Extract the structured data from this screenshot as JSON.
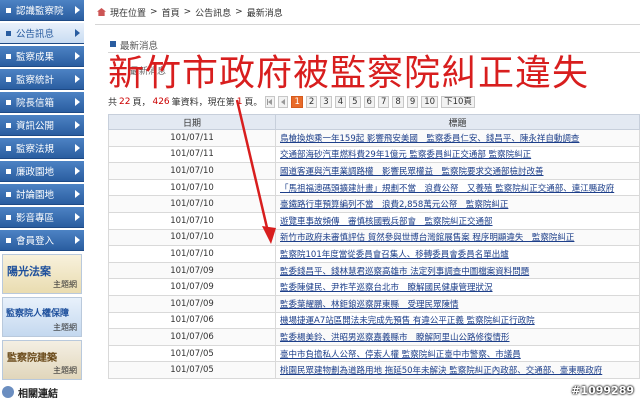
{
  "sidebar": {
    "items": [
      {
        "label": "認識監察院",
        "active": false
      },
      {
        "label": "公告訊息",
        "active": true
      },
      {
        "label": "監察成果",
        "active": false
      },
      {
        "label": "監察統計",
        "active": false
      },
      {
        "label": "院長信箱",
        "active": false
      },
      {
        "label": "資訊公開",
        "active": false
      },
      {
        "label": "監察法規",
        "active": false
      },
      {
        "label": "廉政園地",
        "active": false
      },
      {
        "label": "討論園地",
        "active": false
      },
      {
        "label": "影音專區",
        "active": false
      },
      {
        "label": "會員登入",
        "active": false
      }
    ],
    "banners": [
      {
        "title": "陽光法案",
        "subtitle": "主題網"
      },
      {
        "title": "監察院人權保障",
        "subtitle": "主題網"
      },
      {
        "title": "監察院建築",
        "subtitle": "主題網"
      }
    ],
    "related_label": "相關連結"
  },
  "breadcrumb": {
    "location": "現在位置",
    "items": [
      "首頁",
      "公告訊息",
      "最新消息"
    ],
    "sep": ">"
  },
  "section_title": "最新消息",
  "list_label": "最新消息",
  "overlay_caption": "新竹市政府被監察院糾正違失",
  "paging": {
    "prefix": "共",
    "total_items": "22",
    "mid": "頁，",
    "total_records": "426",
    "mid2": "筆資料，現在第",
    "current": "1",
    "suffix": "頁。",
    "pages": [
      "1",
      "2",
      "3",
      "4",
      "5",
      "6",
      "7",
      "8",
      "9",
      "10"
    ],
    "next10": "下10頁"
  },
  "table": {
    "headers": [
      "日期",
      "標題"
    ],
    "rows": [
      {
        "date": "101/07/11",
        "title": "鳥槍換炮乘一年159起 影響飛安美國　監察委員仁安、錢昌平、陳永祥自動調查"
      },
      {
        "date": "101/07/11",
        "title": "交通部海砂汽車燃料費29年1億元 監察委員糾正交通部 監察院糾正"
      },
      {
        "date": "101/07/10",
        "title": "國道客運與汽車業調路權　影響民眾權益　監察院要求交通部檢討改善"
      },
      {
        "date": "101/07/10",
        "title": "「馬祖福澳碼頭擴建計畫」規劃不當　浪費公帑　又養殖 監察院糾正交通部、連江縣政府"
      },
      {
        "date": "101/07/10",
        "title": "臺鐵路行車預算編列不當　浪費2,858萬元公帑　監察院糾正"
      },
      {
        "date": "101/07/10",
        "title": "遊覽車事故頻傳　審慎核國戰兵部會　監察院糾正交通部"
      },
      {
        "date": "101/07/10",
        "title": "新竹市政府未審慎評估 貿然參與世博台灣館展售案 程序明顯違失　監察院糾正"
      },
      {
        "date": "101/07/10",
        "title": "監察院101年度當從委員會召集人、移轉委員會委員名單出爐"
      },
      {
        "date": "101/07/09",
        "title": "監委錢昌平、錢林慧君巡察高雄市 法定列事調查中圖檔案資料問題"
      },
      {
        "date": "101/07/09",
        "title": "監委陳健民、尹祚芊巡察台北市　瞭解國民健康管理狀況"
      },
      {
        "date": "101/07/09",
        "title": "監委葉耀鵬、林鉅鋃巡察屏東縣　受理民眾陳情"
      },
      {
        "date": "101/07/06",
        "title": "機場捷運A7站區開法未完成先預售 有違公平正義 監察院糾正行政院"
      },
      {
        "date": "101/07/06",
        "title": "監委楊美鈴、洪昭男巡察嘉義縣市　瞭解阿里山公路修復情形"
      },
      {
        "date": "101/07/05",
        "title": "臺中市負擔私人公帑、停索人權 監察院糾正臺中市警察、市議員"
      },
      {
        "date": "101/07/05",
        "title": "桃園民眾建物劃為道路用地 拖延50年未解決 監察院糾正內政部、交通部、臺東縣政府"
      }
    ]
  },
  "watermark": "#1099289"
}
